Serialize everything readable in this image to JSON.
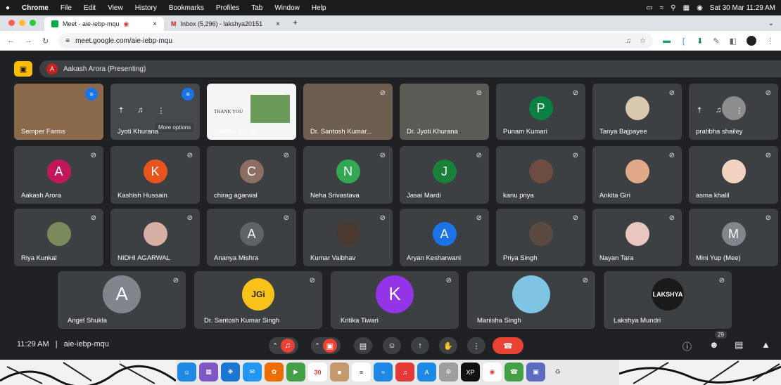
{
  "menubar": {
    "apple": "",
    "items": [
      "Chrome",
      "File",
      "Edit",
      "View",
      "History",
      "Bookmarks",
      "Profiles",
      "Tab",
      "Window",
      "Help"
    ],
    "datetime": "Sat 30 Mar 11:29 AM"
  },
  "tabs": [
    {
      "label": "Meet - aie-iebp-mqu",
      "close": "×"
    },
    {
      "label": "Inbox (5,296) - lakshya20151",
      "close": "×"
    }
  ],
  "tab_plus": "+",
  "address": {
    "url": "meet.google.com/aie-iebp-mqu"
  },
  "presenting": {
    "initial": "A",
    "label": "Aakash Arora (Presenting)"
  },
  "tooltip": "More options",
  "tiles": [
    {
      "name": "Semper Farms",
      "initial": "",
      "color": "#8a6a4a"
    },
    {
      "name": "Jyoti Khurana",
      "initial": "",
      "color": "#45494d"
    },
    {
      "name": "Aakash Arora...",
      "initial": "",
      "color": "#f5f5f5",
      "slide": "THANK YOU"
    },
    {
      "name": "Dr. Santosh Kumar...",
      "initial": "",
      "color": "#6e5e50"
    },
    {
      "name": "Dr. Jyoti Khurana",
      "initial": "",
      "color": "#5b5a55"
    },
    {
      "name": "Punam Kumari",
      "initial": "P",
      "color": "#0b8043"
    },
    {
      "name": "Tanya Bajpayee",
      "initial": "",
      "color": "#d9c9b0"
    },
    {
      "name": "pratibha shailey",
      "initial": "",
      "color": "#8d8d8d"
    },
    {
      "name": "Aakash Arora",
      "initial": "A",
      "color": "#c2185b"
    },
    {
      "name": "Kashish Hussain",
      "initial": "K",
      "color": "#e8541c"
    },
    {
      "name": "chirag agarwal",
      "initial": "C",
      "color": "#8d6e63"
    },
    {
      "name": "Neha Srivastava",
      "initial": "N",
      "color": "#33a852"
    },
    {
      "name": "Jasai Mardi",
      "initial": "J",
      "color": "#188038"
    },
    {
      "name": "kanu priya",
      "initial": "",
      "color": "#6d4c41"
    },
    {
      "name": "Ankita Giri",
      "initial": "",
      "color": "#e1a989"
    },
    {
      "name": "asma khalil",
      "initial": "",
      "color": "#f2d2c0"
    },
    {
      "name": "Riya Kunkal",
      "initial": "",
      "color": "#7a8a5a"
    },
    {
      "name": "NIDHI AGARWAL",
      "initial": "",
      "color": "#d7b0a5"
    },
    {
      "name": "Ananya Mishra",
      "initial": "A",
      "color": "#5f6368"
    },
    {
      "name": "Kumar Vaibhav",
      "initial": "",
      "color": "#4a3a30"
    },
    {
      "name": "Aryan Kesharwani",
      "initial": "A",
      "color": "#1a73e8"
    },
    {
      "name": "Priya Singh",
      "initial": "",
      "color": "#5a4a40"
    },
    {
      "name": "Nayan Tara",
      "initial": "",
      "color": "#e9c7c0"
    },
    {
      "name": "Mini Yup (Mee)",
      "initial": "M",
      "color": "#80868b"
    },
    {
      "name": "Angel Shukla",
      "initial": "A",
      "color": "#80868b"
    },
    {
      "name": "Dr. Santosh Kumar Singh",
      "initial": "",
      "color": "#f9c21a",
      "logo": "JGi"
    },
    {
      "name": "Kritika Tiwari",
      "initial": "K",
      "color": "#9334e6"
    },
    {
      "name": "Manisha Singh",
      "initial": "",
      "color": "#7fc4e3"
    },
    {
      "name": "Lakshya Mundri",
      "initial": "",
      "color": "#1a1a1a",
      "logo": "LAKSHYA"
    }
  ],
  "footer": {
    "time": "11:29 AM",
    "meeting_code": "aie-iebp-mqu",
    "people_count": "29"
  },
  "dock": {
    "calendar_day": "30"
  }
}
